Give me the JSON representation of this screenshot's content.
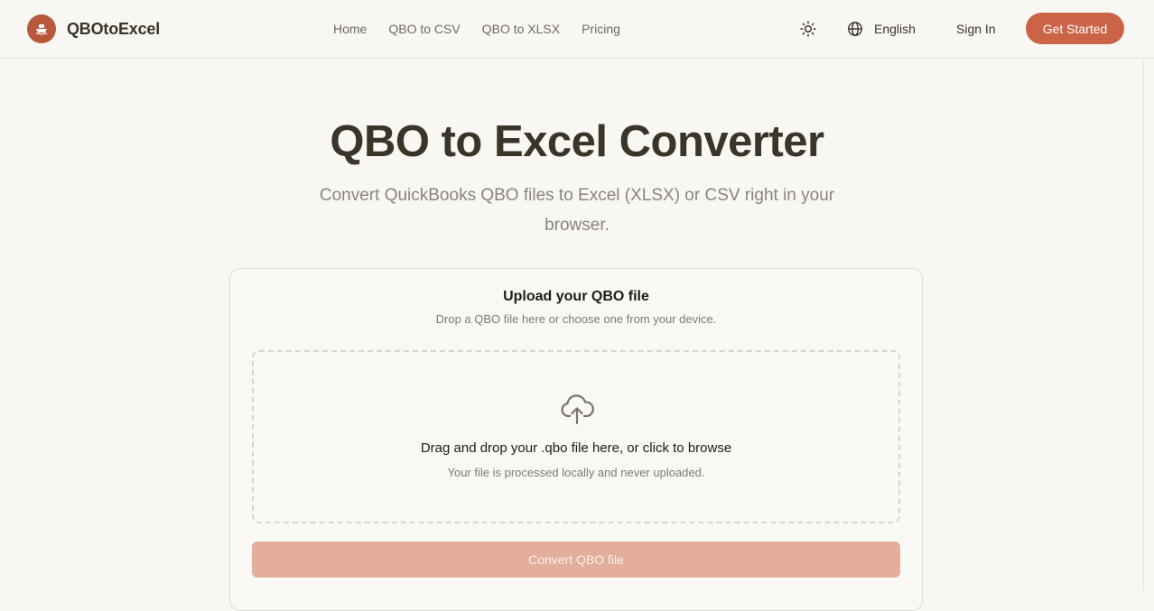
{
  "brand": {
    "name": "QBOtoExcel",
    "icon": "logo-ship-icon",
    "accent": "#cb6446"
  },
  "nav": {
    "items": [
      {
        "label": "Home"
      },
      {
        "label": "QBO to CSV"
      },
      {
        "label": "QBO to XLSX"
      },
      {
        "label": "Pricing"
      }
    ]
  },
  "header_actions": {
    "theme_icon": "sun-icon",
    "language_icon": "globe-icon",
    "language": "English",
    "sign_in": "Sign In",
    "get_started": "Get Started"
  },
  "hero": {
    "title": "QBO to Excel Converter",
    "subtitle": "Convert QuickBooks QBO files to Excel (XLSX) or CSV right in your browser."
  },
  "upload_card": {
    "title": "Upload your QBO file",
    "description": "Drop a QBO file here or choose one from your device.",
    "dropzone": {
      "icon": "cloud-upload-icon",
      "main_text": "Drag and drop your .qbo file here, or click to browse",
      "sub_text": "Your file is processed locally and never uploaded."
    },
    "convert_button": "Convert QBO file"
  }
}
